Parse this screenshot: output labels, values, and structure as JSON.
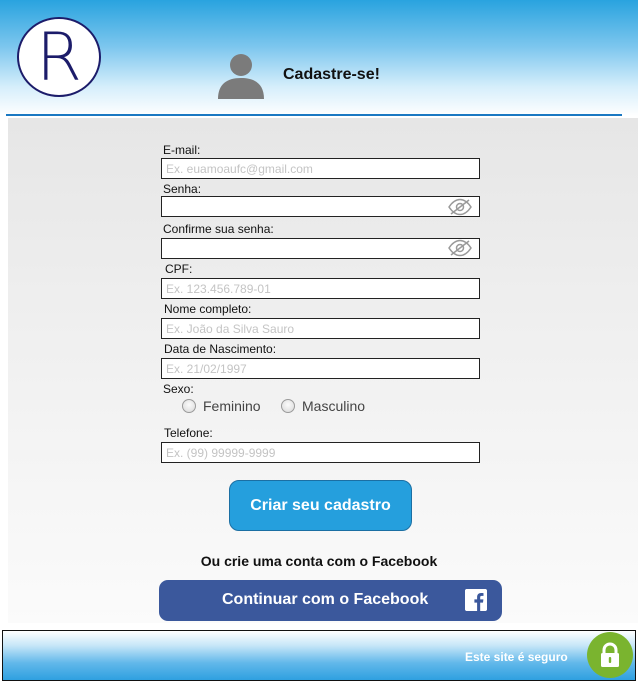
{
  "header": {
    "logo_letter": "R",
    "title": "Cadastre-se!",
    "avatar_icon": "user-silhouette-icon"
  },
  "form": {
    "email": {
      "label": "E-mail:",
      "placeholder": "Ex. euamoaufc@gmail.com",
      "value": ""
    },
    "password": {
      "label": "Senha:",
      "placeholder": "",
      "value": ""
    },
    "confirm_password": {
      "label": "Confirme sua senha:",
      "placeholder": "",
      "value": ""
    },
    "cpf": {
      "label": "CPF:",
      "placeholder": "Ex. 123.456.789-01",
      "value": ""
    },
    "full_name": {
      "label": "Nome completo:",
      "placeholder": "Ex. João da Silva Sauro",
      "value": ""
    },
    "birth_date": {
      "label": "Data de Nascimento:",
      "placeholder": "Ex. 21/02/1997",
      "value": ""
    },
    "sex": {
      "label": "Sexo:",
      "options": [
        "Feminino",
        "Masculino"
      ],
      "selected": null
    },
    "phone": {
      "label": "Telefone:",
      "placeholder": "Ex. (99) 99999-9999",
      "value": ""
    },
    "password_toggle_icon": "eye-slash-icon",
    "submit_label": "Criar seu cadastro"
  },
  "facebook": {
    "prompt": "Ou crie uma conta com o Facebook",
    "button_label": "Continuar com o Facebook",
    "icon": "facebook-icon"
  },
  "footer": {
    "secure_text": "Este site é seguro",
    "lock_icon": "lock-icon"
  },
  "colors": {
    "header_blue": "#29a3df",
    "submit_blue": "#259fdd",
    "facebook_blue": "#3b589c",
    "lock_green": "#7ab42f",
    "logo_navy": "#1c1c6a"
  }
}
